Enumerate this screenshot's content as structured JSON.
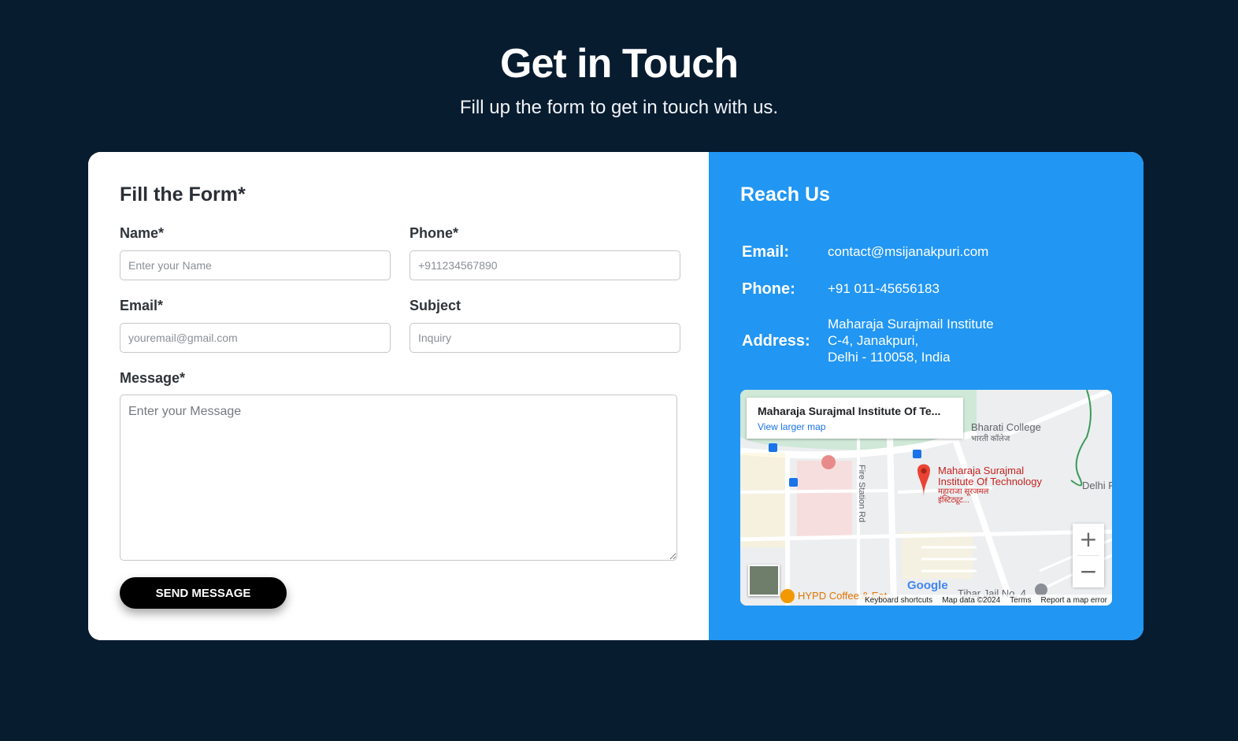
{
  "header": {
    "title": "Get in Touch",
    "subtitle": "Fill up the form to get in touch with us."
  },
  "form": {
    "title": "Fill the Form*",
    "name_label": "Name*",
    "name_placeholder": "Enter your Name",
    "phone_label": "Phone*",
    "phone_placeholder": "+911234567890",
    "email_label": "Email*",
    "email_placeholder": "youremail@gmail.com",
    "subject_label": "Subject",
    "subject_placeholder": "Inquiry",
    "message_label": "Message*",
    "message_placeholder": "Enter your Message",
    "send_label": "SEND MESSAGE"
  },
  "reach": {
    "title": "Reach Us",
    "email_label": "Email:",
    "email_value": "contact@msijanakpuri.com",
    "phone_label": "Phone:",
    "phone_value": "+91 011-45656183",
    "address_label": "Address:",
    "address_lines": [
      "Maharaja Surajmail Institute",
      "C-4, Janakpuri,",
      "Delhi - 110058, India"
    ]
  },
  "map": {
    "place_name": "Maharaja Surajmal Institute Of Te...",
    "view_larger": "View larger map",
    "labels": {
      "bharati": "Bharati College",
      "bharati_hi": "भारती कॉलेज",
      "msit_1": "Maharaja Surajmal",
      "msit_2": "Institute Of Technology",
      "msit_hi_1": "महाराजा सूरजमल",
      "msit_hi_2": "इंस्टिट्यूट...",
      "fire_station": "Fire Station Rd",
      "delhi": "Delhi F",
      "hypd": "HYPD Coffee & Eat",
      "tihar": "Tihar Jail No. 4"
    },
    "zoom_in": "+",
    "zoom_out": "−",
    "google": "Google",
    "footer": {
      "shortcuts": "Keyboard shortcuts",
      "data": "Map data ©2024",
      "terms": "Terms",
      "report": "Report a map error"
    }
  },
  "colors": {
    "background": "#081c30",
    "reach_panel": "#2196f3",
    "send_button": "#000000",
    "pin": "#ea4335"
  }
}
